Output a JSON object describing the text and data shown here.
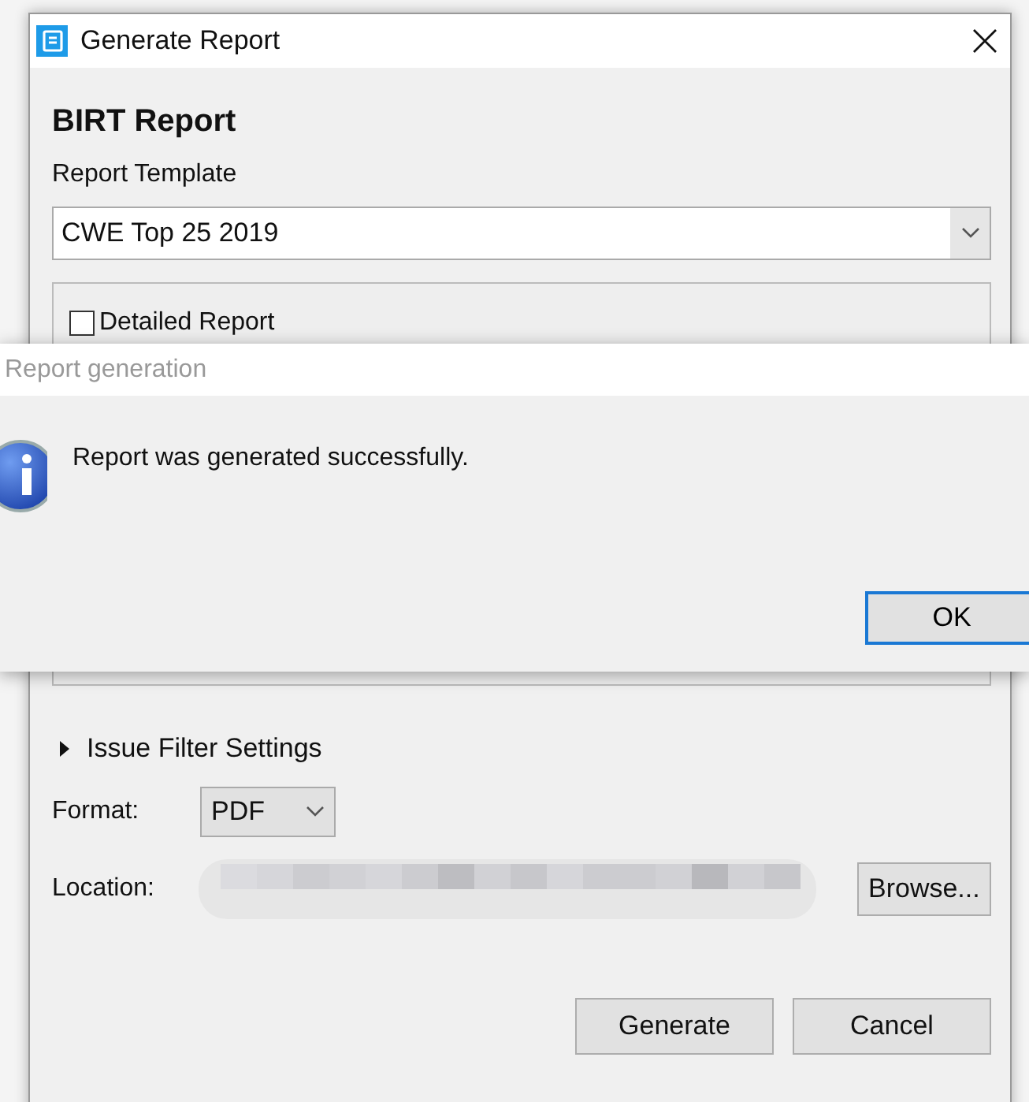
{
  "dialog": {
    "title": "Generate Report",
    "heading": "BIRT Report",
    "template_label": "Report Template",
    "template_value": "CWE Top 25 2019",
    "options": [
      {
        "label": "Detailed Report",
        "checked": false
      }
    ],
    "filter_section": {
      "label": "Issue Filter Settings",
      "expanded": false
    },
    "format_label": "Format:",
    "format_value": "PDF",
    "location_label": "Location:",
    "browse_button": "Browse...",
    "buttons": [
      "Generate",
      "Cancel"
    ]
  },
  "message_box": {
    "title": "Report generation",
    "message": "Report was generated successfully.",
    "button": "OK"
  }
}
